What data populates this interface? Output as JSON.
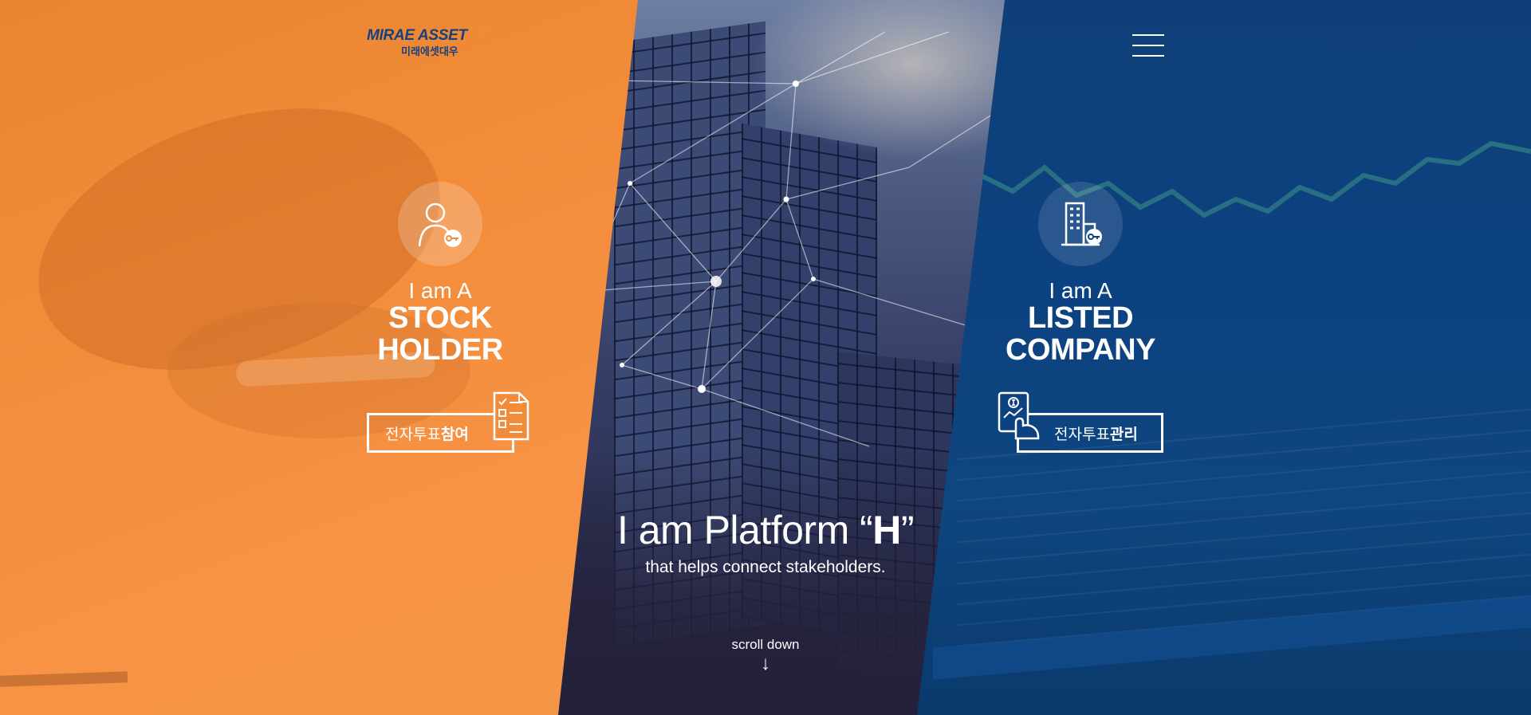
{
  "brand": {
    "logo_text": "MIRAE ASSET",
    "logo_subtext": "미래에셋대우",
    "primary_color": "#f28c39",
    "secondary_color": "#0c4281"
  },
  "header": {
    "menu_icon": "hamburger-menu-icon"
  },
  "left_panel": {
    "icon": "user-key-icon",
    "intro": "I am A",
    "title_line1": "STOCK",
    "title_line2": "HOLDER",
    "button_text_plain": "전자투표",
    "button_text_bold": "참여",
    "button_icon": "checklist-document-icon"
  },
  "right_panel": {
    "icon": "building-key-icon",
    "intro": "I am A",
    "title_line1": "LISTED",
    "title_line2": "COMPANY",
    "button_text_plain": "전자투표",
    "button_text_bold": "관리",
    "button_icon": "tablet-hand-icon"
  },
  "center": {
    "headline_prefix": "I am Platform “",
    "headline_bold": "H",
    "headline_suffix": "”",
    "subline": "that helps connect stakeholders.",
    "scroll_label": "scroll down",
    "scroll_icon": "down-arrow-icon"
  }
}
